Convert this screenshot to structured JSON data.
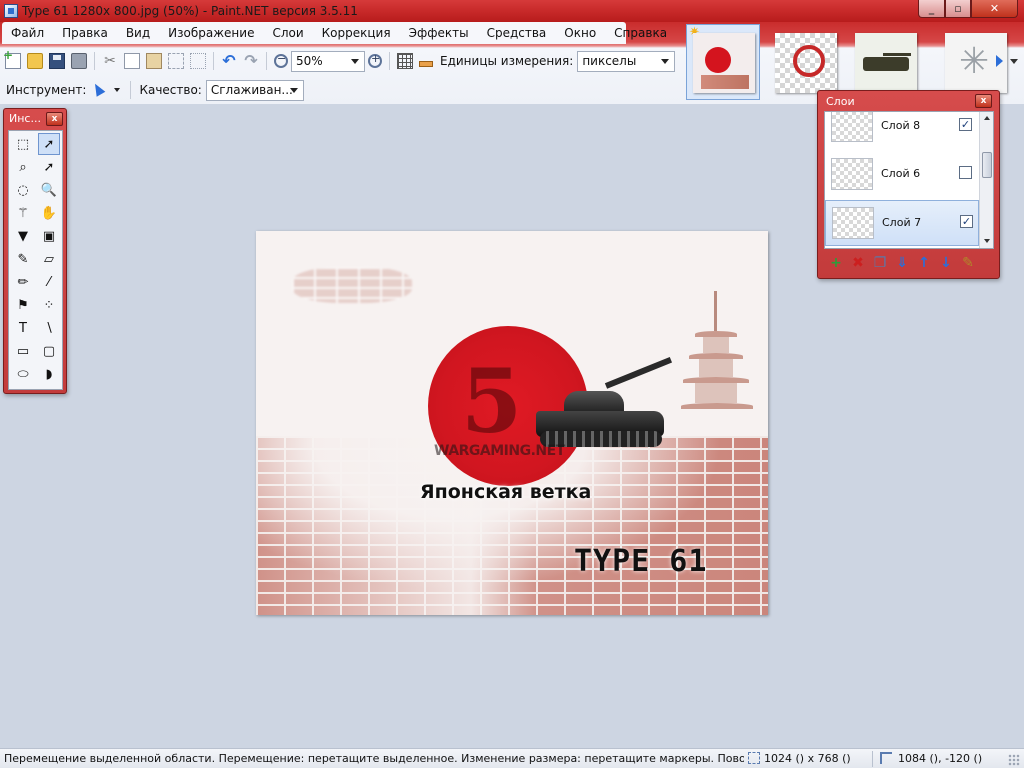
{
  "window": {
    "title": "Type 61 1280x 800.jpg (50%) - Paint.NET версия 3.5.11",
    "minimize_icon": "_",
    "maximize_icon": "▫",
    "close_icon": "✕"
  },
  "menu": {
    "items": [
      "Файл",
      "Правка",
      "Вид",
      "Изображение",
      "Слои",
      "Коррекция",
      "Эффекты",
      "Средства",
      "Окно",
      "Справка"
    ]
  },
  "toolbar": {
    "zoom_value": "50%",
    "units_label": "Единицы измерения:",
    "units_value": "пикселы",
    "icons": [
      "new-icon",
      "open-icon",
      "save-icon",
      "print-icon",
      "cut-icon",
      "copy-icon",
      "paste-icon",
      "crop-icon",
      "deselect-icon",
      "undo-icon",
      "redo-icon",
      "zoom-out-icon",
      "zoom-in-icon",
      "grid-icon",
      "ruler-icon"
    ]
  },
  "toolbar2": {
    "tool_label": "Инструмент:",
    "quality_label": "Качество:",
    "quality_value": "Сглаживан..."
  },
  "thumbnails": [
    {
      "name": "Type 61 1280x 800.jpg",
      "active": true,
      "unsaved": true
    },
    {
      "name": "wargaming-logo",
      "active": false
    },
    {
      "name": "tank-image",
      "active": false
    },
    {
      "name": "cracked-glass",
      "active": false
    }
  ],
  "tools_panel": {
    "title": "Инс...",
    "close_label": "x",
    "tools": [
      {
        "name": "rectangle-select",
        "glyph": "⬚"
      },
      {
        "name": "move-selection",
        "glyph": "➚",
        "selected": true
      },
      {
        "name": "lasso-select",
        "glyph": "⌕"
      },
      {
        "name": "move-selected",
        "glyph": "➚"
      },
      {
        "name": "ellipse-select",
        "glyph": "◌"
      },
      {
        "name": "zoom",
        "glyph": "🔍"
      },
      {
        "name": "magic-wand",
        "glyph": "⚚"
      },
      {
        "name": "pan",
        "glyph": "✋"
      },
      {
        "name": "paint-bucket",
        "glyph": "▼"
      },
      {
        "name": "gradient",
        "glyph": "▣"
      },
      {
        "name": "paintbrush",
        "glyph": "✎"
      },
      {
        "name": "eraser",
        "glyph": "▱"
      },
      {
        "name": "pencil",
        "glyph": "✏"
      },
      {
        "name": "color-picker",
        "glyph": "⁄"
      },
      {
        "name": "clone-stamp",
        "glyph": "⚑"
      },
      {
        "name": "recolor",
        "glyph": "⁘"
      },
      {
        "name": "text",
        "glyph": "T"
      },
      {
        "name": "line-curve",
        "glyph": "∖"
      },
      {
        "name": "rectangle",
        "glyph": "▭"
      },
      {
        "name": "rounded-rectangle",
        "glyph": "▢"
      },
      {
        "name": "ellipse",
        "glyph": "⬭"
      },
      {
        "name": "freeform-shape",
        "glyph": "◗"
      }
    ]
  },
  "layers_panel": {
    "title": "Слои",
    "close_label": "x",
    "layers": [
      {
        "name": "Слой 8",
        "visible": true,
        "selected": false
      },
      {
        "name": "Слой 6",
        "visible": false,
        "selected": false
      },
      {
        "name": "Слой 7",
        "visible": true,
        "selected": true
      }
    ],
    "buttons": [
      {
        "name": "add-layer",
        "glyph": "+",
        "color": "#2e9c3a"
      },
      {
        "name": "delete-layer",
        "glyph": "✖",
        "color": "#cc1f1f"
      },
      {
        "name": "duplicate-layer",
        "glyph": "❐",
        "color": "#5b78a8"
      },
      {
        "name": "merge-layer-down",
        "glyph": "⇓",
        "color": "#2c6ed8"
      },
      {
        "name": "move-layer-up",
        "glyph": "↑",
        "color": "#2c6ed8"
      },
      {
        "name": "move-layer-down",
        "glyph": "↓",
        "color": "#2c6ed8"
      },
      {
        "name": "layer-properties",
        "glyph": "✎",
        "color": "#b08a2a"
      }
    ]
  },
  "canvas_image": {
    "heading": "Японская ветка",
    "logo": "WARGAMING.NET",
    "tank_name": "TYPE 61",
    "emblem_numeral": "5"
  },
  "status": {
    "message": "Перемещение выделенной области. Перемещение: перетащите выделенное. Изменение размера: перетащите маркеры. Поворот: г",
    "image_size": "1024 () x 768 ()",
    "cursor_position": "1084 (), -120 ()"
  },
  "colors": {
    "accent": "#c62828",
    "workspace": "#cdd5e2",
    "selection": "#cfe0f7"
  }
}
